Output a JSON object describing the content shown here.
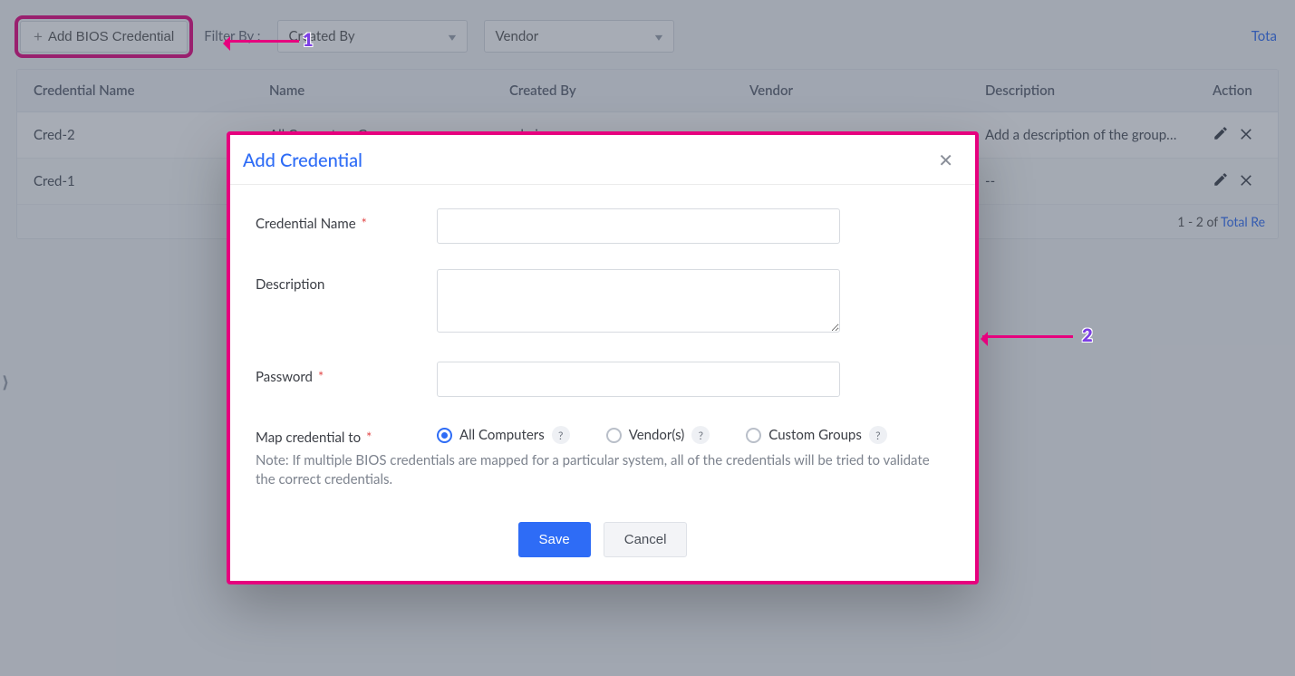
{
  "toolbar": {
    "add_button_label": "Add BIOS Credential",
    "filter_label": "Filter By :",
    "filter_created_by": "Created By",
    "filter_vendor": "Vendor",
    "total_link": "Tota"
  },
  "table": {
    "headers": {
      "credential_name": "Credential Name",
      "name": "Name",
      "created_by": "Created By",
      "vendor": "Vendor",
      "description": "Description",
      "action": "Action"
    },
    "rows": [
      {
        "credential_name": "Cred-2",
        "name": "All Computers Group",
        "created_by": "admin",
        "vendor": "--",
        "description": "Add a description of the groups ..."
      },
      {
        "credential_name": "Cred-1",
        "name": "",
        "created_by": "",
        "vendor": "",
        "description": "--"
      }
    ],
    "footer_prefix": "1 - 2 of ",
    "footer_link": "Total Re"
  },
  "modal": {
    "title": "Add Credential",
    "labels": {
      "credential_name": "Credential Name",
      "description": "Description",
      "password": "Password",
      "map_to": "Map credential to"
    },
    "required_mark": "*",
    "radios": {
      "all": "All Computers",
      "vendors": "Vendor(s)",
      "custom": "Custom Groups"
    },
    "help_mark": "?",
    "note": "Note: If multiple BIOS credentials are mapped for a particular system, all of the credentials will be tried to validate the correct credentials.",
    "save": "Save",
    "cancel": "Cancel"
  },
  "annotations": {
    "num1": "1",
    "num2": "2"
  }
}
